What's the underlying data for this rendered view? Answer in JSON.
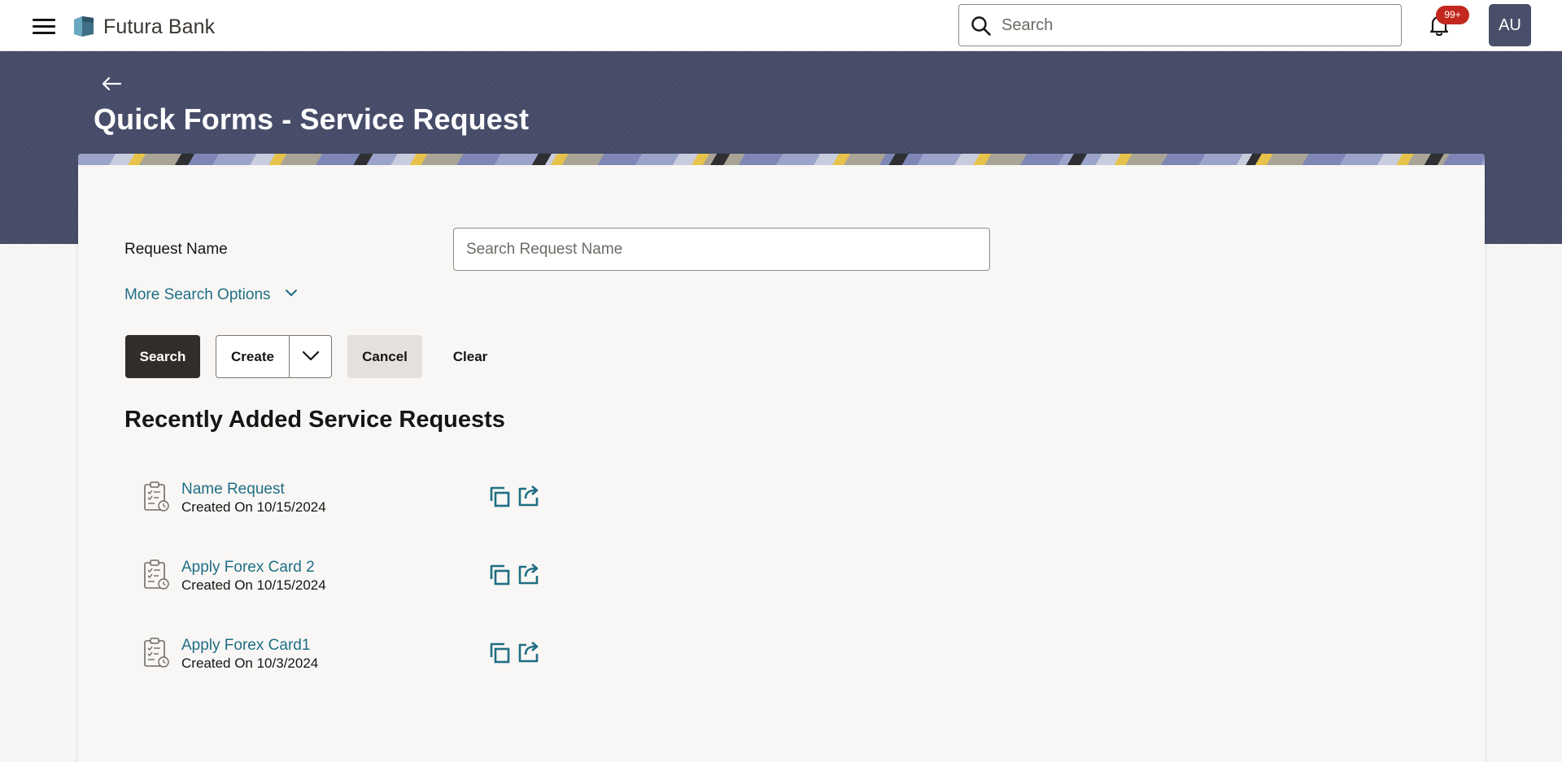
{
  "header": {
    "brand": "Futura Bank",
    "search_placeholder": "Search",
    "notification_badge": "99+",
    "avatar_initials": "AU"
  },
  "page": {
    "title": "Quick Forms - Service Request"
  },
  "form": {
    "request_name_label": "Request Name",
    "request_name_placeholder": "Search Request Name",
    "more_options_label": "More Search Options"
  },
  "actions": {
    "search": "Search",
    "create": "Create",
    "cancel": "Cancel",
    "clear": "Clear"
  },
  "recent": {
    "title": "Recently Added Service Requests",
    "items": [
      {
        "name": "Name Request",
        "created": "Created On 10/15/2024"
      },
      {
        "name": "Apply Forex Card 2",
        "created": "Created On 10/15/2024"
      },
      {
        "name": "Apply Forex Card1",
        "created": "Created On 10/3/2024"
      }
    ]
  },
  "colors": {
    "banner": "#474d6a",
    "link": "#1f6e84",
    "primary_button": "#312d2a",
    "badge": "#c2281d",
    "avatar": "#4a4f69"
  },
  "icons": [
    "menu-icon",
    "bank-logo-icon",
    "search-icon",
    "bell-icon",
    "back-arrow-icon",
    "chevron-down-icon",
    "document-icon",
    "copy-icon",
    "open-external-icon"
  ]
}
